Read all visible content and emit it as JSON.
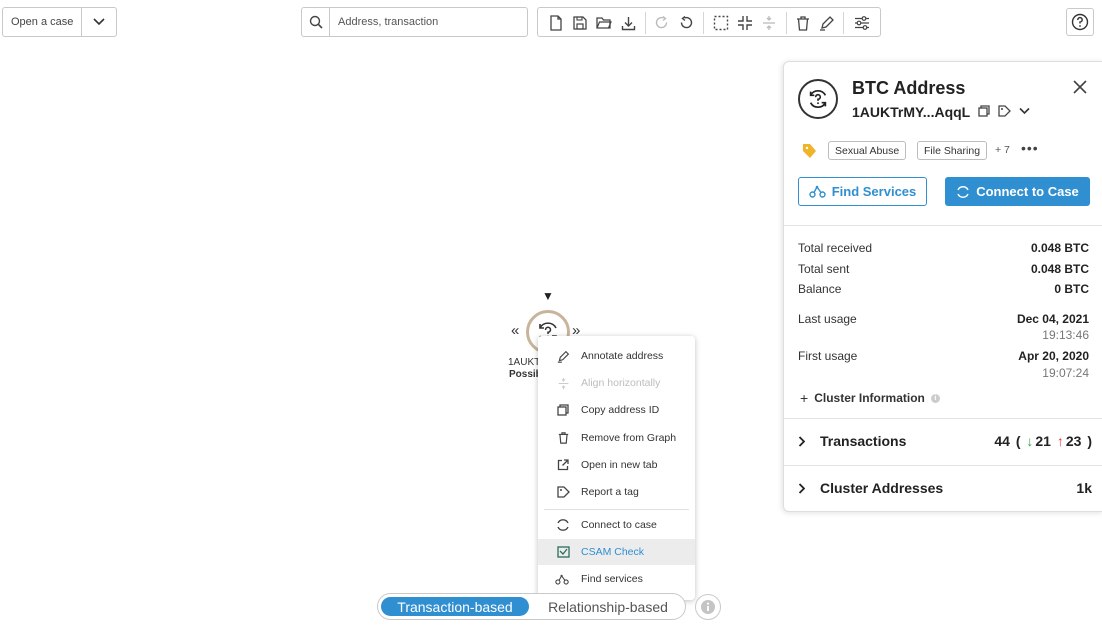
{
  "toolbar": {
    "case_select_label": "Open a case",
    "search_placeholder": "Address, transaction"
  },
  "graph": {
    "node_address": "1AUKT",
    "node_label": "Possib"
  },
  "context_menu": {
    "items": [
      {
        "label": "Annotate address",
        "icon": "pen-icon",
        "disabled": false
      },
      {
        "label": "Align horizontally",
        "icon": "align-icon",
        "disabled": true
      },
      {
        "label": "Copy address ID",
        "icon": "copy-icon",
        "disabled": false
      },
      {
        "label": "Remove from Graph",
        "icon": "trash-icon",
        "disabled": false
      },
      {
        "label": "Open in new tab",
        "icon": "external-link-icon",
        "disabled": false
      },
      {
        "label": "Report a tag",
        "icon": "tag-icon",
        "disabled": false
      },
      {
        "label": "Connect to case",
        "icon": "connect-icon",
        "disabled": false
      },
      {
        "label": "CSAM Check",
        "icon": "csam-check-icon",
        "disabled": false,
        "highlighted": true
      },
      {
        "label": "Find services",
        "icon": "services-icon",
        "disabled": false
      }
    ]
  },
  "view_switch": {
    "active": "Transaction-based",
    "inactive": "Relationship-based"
  },
  "panel": {
    "title": "BTC Address",
    "address": "1AUKTrMY...AqqL",
    "tags": [
      "Sexual Abuse",
      "File Sharing"
    ],
    "tags_more": "+ 7",
    "find_services_label": "Find Services",
    "connect_label": "Connect to Case",
    "stats": {
      "total_received_label": "Total received",
      "total_received": "0.048 BTC",
      "total_sent_label": "Total sent",
      "total_sent": "0.048 BTC",
      "balance_label": "Balance",
      "balance": "0 BTC",
      "last_usage_label": "Last usage",
      "last_usage_date": "Dec 04, 2021",
      "last_usage_time": "19:13:46",
      "first_usage_label": "First usage",
      "first_usage_date": "Apr 20, 2020",
      "first_usage_time": "19:07:24"
    },
    "cluster_info_label": "Cluster Information",
    "transactions": {
      "label": "Transactions",
      "total": "44",
      "in": "21",
      "out": "23"
    },
    "cluster_addresses": {
      "label": "Cluster Addresses",
      "value": "1k"
    }
  },
  "colors": {
    "accent": "#2f8fd1",
    "node_ring": "#c8b49a",
    "tag_icon": "#f0b429",
    "in_arrow": "#2fa84f",
    "out_arrow": "#d9383a"
  }
}
